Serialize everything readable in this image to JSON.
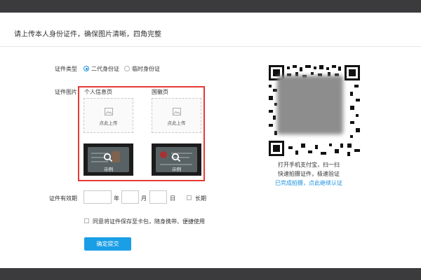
{
  "page": {
    "title": "请上传本人身份证件，确保图片清晰，四角完整"
  },
  "form": {
    "doc_type_label": "证件类型",
    "doc_type_options": [
      "二代身份证",
      "临时身份证"
    ],
    "doc_image_label": "证件图片",
    "front_label": "个人信息页",
    "back_label": "国徽页",
    "upload_text": "点此上传",
    "sample_text": "示例",
    "validity_label": "证件有效期",
    "year_unit": "年",
    "month_unit": "月",
    "day_unit": "日",
    "long_term_label": "长期",
    "save_consent_label": "同意将证件保存至卡包，随身携带、便捷使用",
    "submit_label": "确定提交"
  },
  "qr_panel": {
    "line1": "打开手机支付宝，扫一扫",
    "line2": "快速拍摄证件，极速验证",
    "link": "已完成拍摄，点此继续认证"
  },
  "colors": {
    "accent": "#1a91e0",
    "highlight_border": "#e53935",
    "bars": "#3b3b3d"
  }
}
